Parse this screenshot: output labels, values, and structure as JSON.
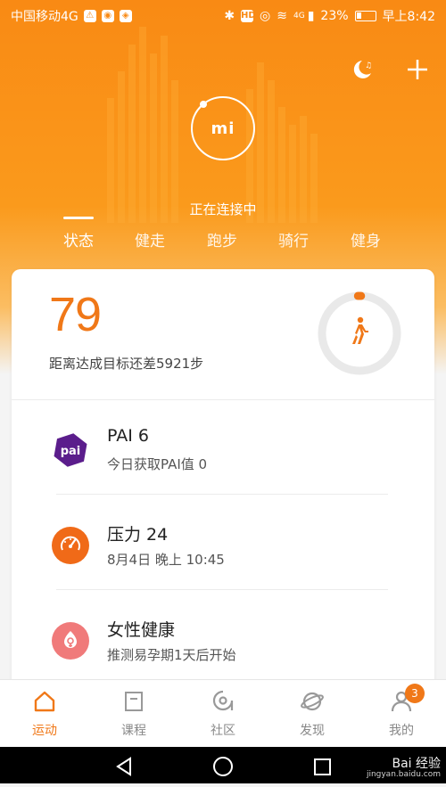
{
  "status_bar": {
    "carrier": "中国移动4G",
    "battery": "23%",
    "time": "早上8:42",
    "network": "4G",
    "hd": "HD"
  },
  "header": {
    "logo": "mi",
    "connecting": "正在连接中",
    "tabs": [
      {
        "label": "状态",
        "active": true
      },
      {
        "label": "健走"
      },
      {
        "label": "跑步"
      },
      {
        "label": "骑行"
      },
      {
        "label": "健身"
      }
    ]
  },
  "summary": {
    "steps": "79",
    "goal_text": "距离达成目标还差5921步",
    "goal_progress": 0.013
  },
  "rows": [
    {
      "icon": "pai-icon",
      "icon_text": "pai",
      "title": "PAI  6",
      "subtitle": "今日获取PAI值  0",
      "color": "#5b1d8c"
    },
    {
      "icon": "gauge-icon",
      "title": "压力  24",
      "subtitle": "8月4日  晚上  10:45",
      "color": "#f06a18"
    },
    {
      "icon": "female-icon",
      "title": "女性健康",
      "subtitle": "推测易孕期1天后开始",
      "color": "#f07a7a"
    }
  ],
  "bottom_nav": {
    "items": [
      {
        "label": "运动",
        "icon": "home-icon",
        "active": true
      },
      {
        "label": "课程",
        "icon": "course-icon"
      },
      {
        "label": "社区",
        "icon": "community-icon"
      },
      {
        "label": "发现",
        "icon": "discover-icon"
      },
      {
        "label": "我的",
        "icon": "profile-icon",
        "badge": "3"
      }
    ]
  },
  "watermark": {
    "text": "Bai 经验",
    "sub": "jingyan.baidu.com"
  },
  "colors": {
    "accent": "#f07818",
    "header": "#f98a14"
  }
}
